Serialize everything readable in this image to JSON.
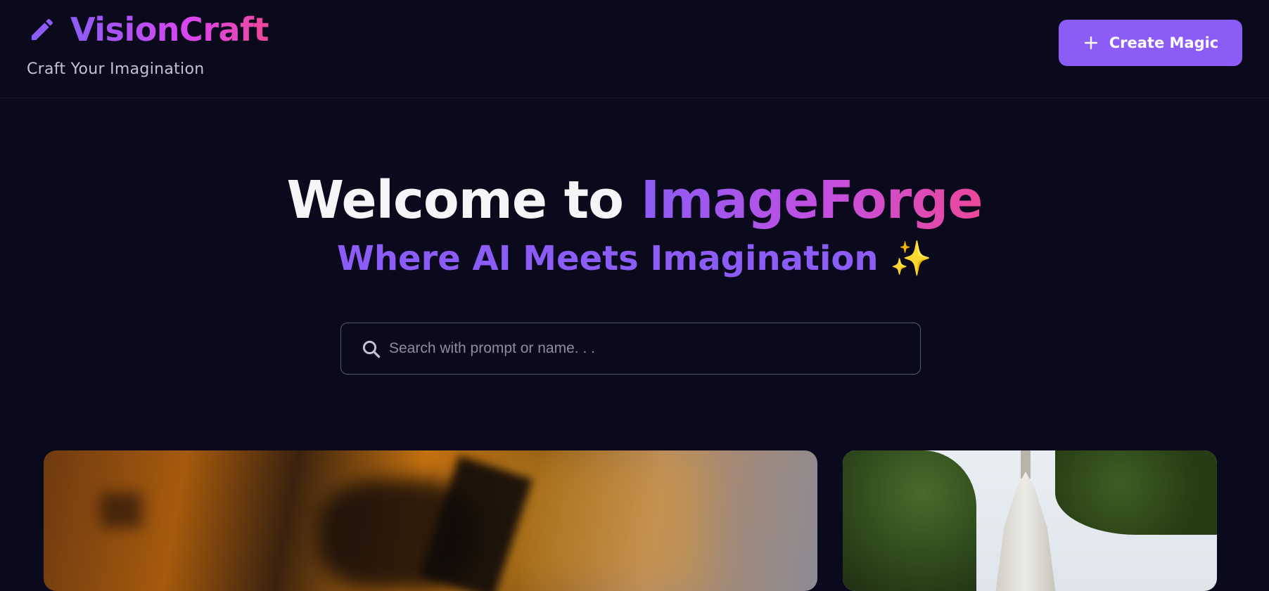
{
  "header": {
    "brand_name": "VisionCraft",
    "tagline": "Craft Your Imagination",
    "brand_icon": "pencil-icon",
    "create_button_label": "Create Magic",
    "create_button_icon": "plus-icon"
  },
  "hero": {
    "title_plain": "Welcome to",
    "title_accent": "ImageForge",
    "subtitle": "Where AI Meets Imagination",
    "subtitle_emoji": "✨"
  },
  "search": {
    "placeholder": "Search with prompt or name. . .",
    "value": "",
    "icon": "search-icon"
  },
  "gallery": {
    "cards": [
      {
        "image": "blurred-orange-photo"
      },
      {
        "image": "white-temple-photo"
      }
    ]
  },
  "colors": {
    "background": "#0b0a1c",
    "accent": "#8b5cf6",
    "accent_pink": "#ec4899",
    "sparkle": "#fbbf24"
  }
}
